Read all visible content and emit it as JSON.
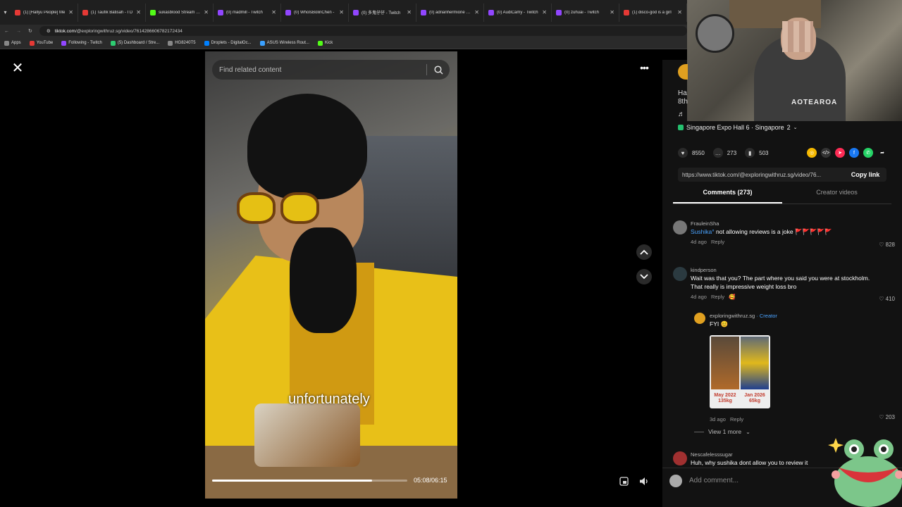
{
  "browser": {
    "tabs": [
      {
        "title": "(1) [Hallyu People] Me",
        "color": "#e53935"
      },
      {
        "title": "(1) Taufik Batisah - I D",
        "color": "#e53935"
      },
      {
        "title": "sukasblood Stream - V",
        "color": "#53fc18"
      },
      {
        "title": "(0) madmill - Twitch",
        "color": "#9146ff"
      },
      {
        "title": "(0) WhoIsBolinChen -",
        "color": "#9146ff"
      },
      {
        "title": "(0) 多鬼仔仔 - Twitch",
        "color": "#9146ff"
      },
      {
        "title": "(0) adrianhermione - Tw",
        "color": "#9146ff"
      },
      {
        "title": "(0) AudiCamy - Twitch",
        "color": "#9146ff"
      },
      {
        "title": "(0) zuhuai - Twitch",
        "color": "#9146ff"
      },
      {
        "title": "(1) disco-god is a girl",
        "color": "#e53935"
      }
    ],
    "url_host": "tiktok.com",
    "url_path": "/@exploringwithruz.sg/video/7614286606782172434",
    "bookmarks": [
      {
        "label": "Apps",
        "color": "#888"
      },
      {
        "label": "YouTube",
        "color": "#e53935"
      },
      {
        "label": "Following - Twitch",
        "color": "#9146ff"
      },
      {
        "label": "(5) Dashboard / Stre...",
        "color": "#2ecc71"
      },
      {
        "label": "HG8240T5",
        "color": "#888"
      },
      {
        "label": "Droplets - DigitalOc...",
        "color": "#0080ff"
      },
      {
        "label": "ASUS Wireless Rout...",
        "color": "#3aa0ff"
      },
      {
        "label": "Kick",
        "color": "#53fc18"
      }
    ]
  },
  "video": {
    "search_placeholder": "Find related content",
    "caption": "unfortunately",
    "time": "05:08/06:15",
    "progress": 0.82
  },
  "sidebar": {
    "partial_title_1": "Ha",
    "partial_title_2": "8th",
    "music_note": "♬",
    "location": "Singapore Expo Hall 6 · Singapore",
    "location_count": "2",
    "likes": "8550",
    "comments_count": "273",
    "saves": "503",
    "link": "https://www.tiktok.com/@exploringwithruz.sg/video/76...",
    "copy_link": "Copy link",
    "tab_comments": "Comments (273)",
    "tab_creator": "Creator videos"
  },
  "comments": [
    {
      "user": "FrauleinSha",
      "mention": "Sushika°",
      "text": " not allowing reviews is a joke 🚩🚩🚩🚩🚩",
      "time": "4d ago",
      "reply": "Reply",
      "likes": "828"
    },
    {
      "user": "kindperson",
      "text": "Wait was that you? The part where you said you were at stockholm. That really is impressive weight loss bro",
      "time": "4d ago",
      "reply": "Reply",
      "likes": "410"
    }
  ],
  "reply": {
    "user": "exploringwithruz.sg",
    "creator": "· Creator",
    "text": "FYI 😊",
    "photo_left": "May 2022 135kg",
    "photo_right": "Jan 2026 65kg",
    "time": "3d ago",
    "reply": "Reply",
    "likes": "203"
  },
  "view_more": "View 1 more",
  "last_comment_user": "Nescafelesssugar",
  "last_comment_text": "Huh, why sushika dont allow you to review it",
  "add_comment_placeholder": "Add comment..."
}
